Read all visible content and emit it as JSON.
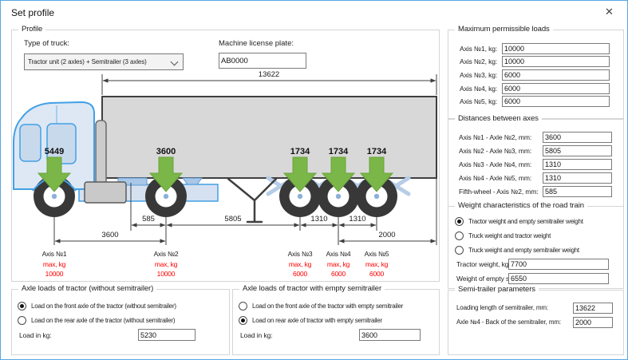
{
  "window": {
    "title": "Set profile",
    "close_glyph": "✕"
  },
  "profile": {
    "group_label": "Profile",
    "type_of_truck_label": "Type of truck:",
    "type_of_truck_value": "Tractor unit (2 axles) + Semitrailer (3 axles)",
    "plate_label": "Machine license plate:",
    "plate_value": "AB0000"
  },
  "diagram": {
    "total_length": "13622",
    "loads": [
      "5449",
      "3600",
      "1734",
      "1734",
      "1734"
    ],
    "dims": {
      "fifth_wheel_to_axis2": "585",
      "axis2_to_axis3": "5805",
      "axis3_to_axis4": "1310",
      "axis4_to_axis5": "1310",
      "axis1_to_axis2": "3600",
      "axis4_to_back": "2000"
    },
    "axes": [
      {
        "name": "Axis №1",
        "max_label": "max, kg",
        "max_value": "10000"
      },
      {
        "name": "Axis №2",
        "max_label": "max, kg",
        "max_value": "10000"
      },
      {
        "name": "Axis №3",
        "max_label": "max, kg",
        "max_value": "6000"
      },
      {
        "name": "Axis №4",
        "max_label": "max, kg",
        "max_value": "6000"
      },
      {
        "name": "Axis №5",
        "max_label": "max, kg",
        "max_value": "6000"
      }
    ]
  },
  "max_loads": {
    "group_label": "Maximum permissible loads",
    "rows": [
      {
        "label": "Axis №1, kg:",
        "value": "10000"
      },
      {
        "label": "Axis №2, kg:",
        "value": "10000"
      },
      {
        "label": "Axis №3, kg:",
        "value": "6000"
      },
      {
        "label": "Axis №4, kg:",
        "value": "6000"
      },
      {
        "label": "Axis №5, kg:",
        "value": "6000"
      }
    ]
  },
  "distances": {
    "group_label": "Distances between axes",
    "rows": [
      {
        "label": "Axis №1 - Axle №2, mm:",
        "value": "3600"
      },
      {
        "label": "Axis №2 - Axle №3, mm:",
        "value": "5805"
      },
      {
        "label": "Axis №3 - Axle №4, mm:",
        "value": "1310"
      },
      {
        "label": "Axis №4 - Axle №5, mm:",
        "value": "1310"
      },
      {
        "label": "Fifth-wheel - Axis №2, mm:",
        "value": "585"
      }
    ]
  },
  "weight_chars": {
    "group_label": "Weight characteristics of the road train",
    "radios": [
      {
        "label": "Tractor weight and empty semitrailer weight",
        "selected": true
      },
      {
        "label": "Truck weight and tractor weight",
        "selected": false
      },
      {
        "label": "Truck weight and empty semitrailer weight",
        "selected": false
      }
    ],
    "fields": [
      {
        "label": "Tractor weight, kg:",
        "value": "7700"
      },
      {
        "label": "Weight of empty semitrailer, kg:",
        "value": "6550"
      }
    ]
  },
  "axle_without": {
    "group_label": "Axle loads of tractor (without semitrailer)",
    "radios": [
      {
        "label": "Load on the front axle of the tractor (without semitrailer)",
        "selected": true
      },
      {
        "label": "Load on the rear axle of the tractor (without semitrailer)",
        "selected": false
      }
    ],
    "load_label": "Load in kg:",
    "load_value": "5230"
  },
  "axle_with": {
    "group_label": "Axle loads of tractor with empty semitrailer",
    "radios": [
      {
        "label": "Load on the front axle of the tractor with empty semitrailer",
        "selected": false
      },
      {
        "label": "Load on rear axle of tractor with empty semitrailer",
        "selected": true
      }
    ],
    "load_label": "Load in kg:",
    "load_value": "3600"
  },
  "semitrailer": {
    "group_label": "Semi-trailer parameters",
    "rows": [
      {
        "label": "Loading length of semitrailer, mm:",
        "value": "13622"
      },
      {
        "label": "Axle №4 - Back of the semitrailer, mm:",
        "value": "2000"
      }
    ]
  },
  "colors": {
    "accent_blue": "#42a0e6",
    "arrow_green": "#7ab648",
    "max_red": "#ff0000"
  }
}
